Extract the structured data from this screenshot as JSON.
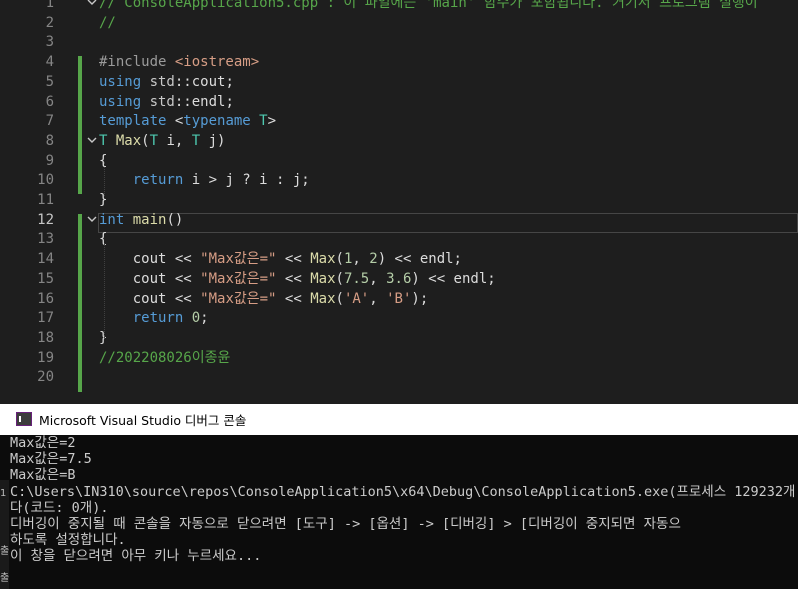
{
  "editor": {
    "line_numbers": [
      "1",
      "2",
      "3",
      "4",
      "5",
      "6",
      "7",
      "8",
      "9",
      "10",
      "11",
      "12",
      "13",
      "14",
      "15",
      "16",
      "17",
      "18",
      "19",
      "20"
    ],
    "active_line": "12",
    "lines": [
      [
        {
          "t": "// ConsoleApplication5.cpp : 이 파일에는 'main' 함수가 포함됩니다. 거기서 프로그램 실행이",
          "c": "cm"
        }
      ],
      [
        {
          "t": "//",
          "c": "cm"
        }
      ],
      [],
      [
        {
          "t": "#include ",
          "c": "pp"
        },
        {
          "t": "<iostream>",
          "c": "inc"
        }
      ],
      [
        {
          "t": "using ",
          "c": "kw"
        },
        {
          "t": "std",
          "c": "ns"
        },
        {
          "t": "::",
          "c": "plain"
        },
        {
          "t": "cout",
          "c": "plain"
        },
        {
          "t": ";",
          "c": "plain"
        }
      ],
      [
        {
          "t": "using ",
          "c": "kw"
        },
        {
          "t": "std",
          "c": "ns"
        },
        {
          "t": "::",
          "c": "plain"
        },
        {
          "t": "endl",
          "c": "plain"
        },
        {
          "t": ";",
          "c": "plain"
        }
      ],
      [
        {
          "t": "template ",
          "c": "kw"
        },
        {
          "t": "<",
          "c": "plain"
        },
        {
          "t": "typename ",
          "c": "kw"
        },
        {
          "t": "T",
          "c": "ty"
        },
        {
          "t": ">",
          "c": "plain"
        }
      ],
      [
        {
          "t": "T ",
          "c": "ty"
        },
        {
          "t": "Max",
          "c": "fn"
        },
        {
          "t": "(",
          "c": "plain"
        },
        {
          "t": "T ",
          "c": "ty"
        },
        {
          "t": "i",
          "c": "plain"
        },
        {
          "t": ", ",
          "c": "plain"
        },
        {
          "t": "T ",
          "c": "ty"
        },
        {
          "t": "j",
          "c": "plain"
        },
        {
          "t": ")",
          "c": "plain"
        }
      ],
      [
        {
          "t": "{",
          "c": "plain"
        }
      ],
      [
        {
          "t": "    ",
          "c": "plain"
        },
        {
          "t": "return ",
          "c": "kw"
        },
        {
          "t": "i > j ? i : j;",
          "c": "plain"
        }
      ],
      [
        {
          "t": "}",
          "c": "plain"
        }
      ],
      [
        {
          "t": "int ",
          "c": "kw"
        },
        {
          "t": "main",
          "c": "fn"
        },
        {
          "t": "()",
          "c": "plain"
        }
      ],
      [
        {
          "t": "{",
          "c": "plain"
        }
      ],
      [
        {
          "t": "    cout << ",
          "c": "plain"
        },
        {
          "t": "\"Max값은=\"",
          "c": "str"
        },
        {
          "t": " << ",
          "c": "plain"
        },
        {
          "t": "Max",
          "c": "fn"
        },
        {
          "t": "(",
          "c": "plain"
        },
        {
          "t": "1",
          "c": "num"
        },
        {
          "t": ", ",
          "c": "plain"
        },
        {
          "t": "2",
          "c": "num"
        },
        {
          "t": ") << endl;",
          "c": "plain"
        }
      ],
      [
        {
          "t": "    cout << ",
          "c": "plain"
        },
        {
          "t": "\"Max값은=\"",
          "c": "str"
        },
        {
          "t": " << ",
          "c": "plain"
        },
        {
          "t": "Max",
          "c": "fn"
        },
        {
          "t": "(",
          "c": "plain"
        },
        {
          "t": "7.5",
          "c": "num"
        },
        {
          "t": ", ",
          "c": "plain"
        },
        {
          "t": "3.6",
          "c": "num"
        },
        {
          "t": ") << endl;",
          "c": "plain"
        }
      ],
      [
        {
          "t": "    cout << ",
          "c": "plain"
        },
        {
          "t": "\"Max값은=\"",
          "c": "str"
        },
        {
          "t": " << ",
          "c": "plain"
        },
        {
          "t": "Max",
          "c": "fn"
        },
        {
          "t": "(",
          "c": "plain"
        },
        {
          "t": "'A'",
          "c": "str"
        },
        {
          "t": ", ",
          "c": "plain"
        },
        {
          "t": "'B'",
          "c": "str"
        },
        {
          "t": ");",
          "c": "plain"
        }
      ],
      [
        {
          "t": "    ",
          "c": "plain"
        },
        {
          "t": "return ",
          "c": "kw"
        },
        {
          "t": "0",
          "c": "num"
        },
        {
          "t": ";",
          "c": "plain"
        }
      ],
      [
        {
          "t": "}",
          "c": "plain"
        }
      ],
      [
        {
          "t": "//202208026이종윤",
          "c": "cm"
        }
      ],
      []
    ],
    "fold_markers": {
      "collapse_icon": "chevron-down-icon",
      "lines": [
        "1",
        "8",
        "12"
      ]
    }
  },
  "console": {
    "title": "Microsoft Visual Studio 디버그 콘솔",
    "icon": "vs-console-icon",
    "output": [
      "Max값은=2",
      "Max값은=7.5",
      "Max값은=B",
      "C:\\Users\\IN310\\source\\repos\\ConsoleApplication5\\x64\\Debug\\ConsoleApplication5.exe(프로세스 129232개",
      "다(코드: 0개).",
      "디버깅이 중지될 때 콘솔을 자동으로 닫으려면 [도구] -> [옵션] -> [디버깅] > [디버깅이 중지되면 자동으",
      "하도록 설정합니다.",
      "이 창을 닫으려면 아무 키나 누르세요..."
    ]
  },
  "left_clip": {
    "labels": [
      "1",
      "출",
      "출"
    ]
  }
}
